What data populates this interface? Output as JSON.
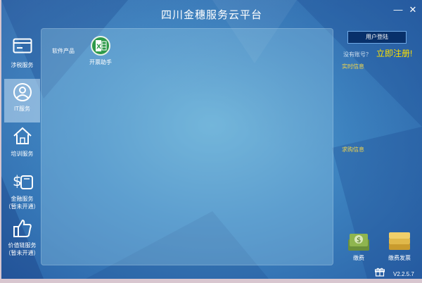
{
  "window": {
    "title": "四川金穗服务云平台"
  },
  "titlebar": {
    "minimize": "—",
    "close": "✕"
  },
  "sidebar": {
    "items": [
      {
        "label": "涉税服务",
        "icon": "card-icon",
        "active": false
      },
      {
        "label": "IT服务",
        "icon": "user-circle-icon",
        "active": true
      },
      {
        "label": "培训服务",
        "icon": "home-icon",
        "active": false
      },
      {
        "label": "金融服务",
        "sublabel": "（暂未开通）",
        "icon": "money-bag-icon",
        "active": false
      },
      {
        "label": "价值链服务",
        "sublabel": "（暂未开通）",
        "icon": "thumbs-up-icon",
        "active": false
      }
    ]
  },
  "main": {
    "category": "软件产品",
    "apps": [
      {
        "label": "开票助手",
        "icon": "excel-icon"
      }
    ]
  },
  "right": {
    "login_label": "用户登陆",
    "no_account": "没有账号？",
    "register": "立即注册!",
    "realtime_header": "实时信息",
    "purchase_header": "求购信息",
    "pay_label": "缴费",
    "pay_invoice_label": "缴费发票",
    "version": "V2.2.5.7"
  },
  "colors": {
    "accent_yellow": "#ffe100",
    "header_yellow": "#f4d64a",
    "login_bg": "#08306a",
    "excel_green": "#2e9a4a"
  }
}
